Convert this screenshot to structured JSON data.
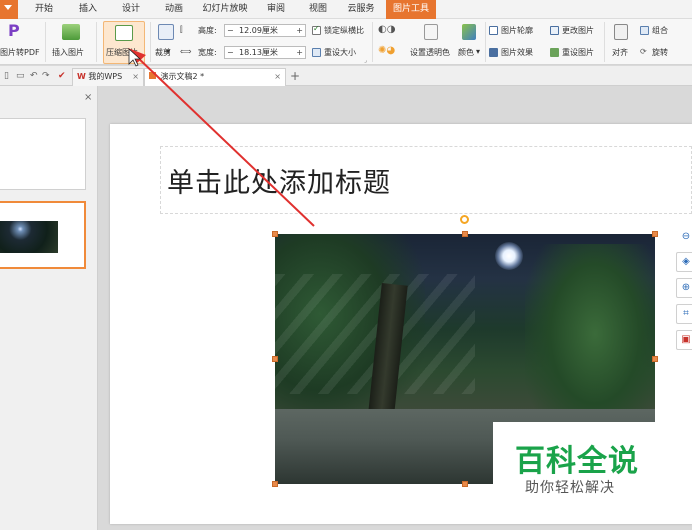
{
  "menu_tabs": [
    "开始",
    "插入",
    "设计",
    "动画",
    "幻灯片放映",
    "审阅",
    "视图",
    "云服务",
    "图片工具"
  ],
  "active_tab": "图片工具",
  "ribbon": {
    "pdf_label": "图片转PDF",
    "insert_picture": "插入图片",
    "compress_picture": "压缩图片",
    "crop": "裁剪",
    "height_label": "高度:",
    "height_value": "12.09厘米",
    "width_label": "宽度:",
    "width_value": "18.13厘米",
    "lock_ratio": "锁定纵横比",
    "reset_size": "重设大小",
    "set_transparent": "设置透明色",
    "color": "颜色",
    "picture_outline": "图片轮廓",
    "picture_effect": "图片效果",
    "change_picture": "更改图片",
    "reset_picture": "重设图片",
    "align": "对齐",
    "rotate": "旋转",
    "group": "组合"
  },
  "doc_tabs": [
    {
      "label": "我的WPS"
    },
    {
      "label": "演示文稿2 *"
    }
  ],
  "slide": {
    "title_placeholder": "单击此处添加标题"
  },
  "watermark": {
    "main": "百科全说",
    "sub": "助你轻松解决"
  },
  "colors": {
    "accent": "#e7752f",
    "watermark_green": "#1aa34a",
    "arrow": "#e0312f"
  }
}
